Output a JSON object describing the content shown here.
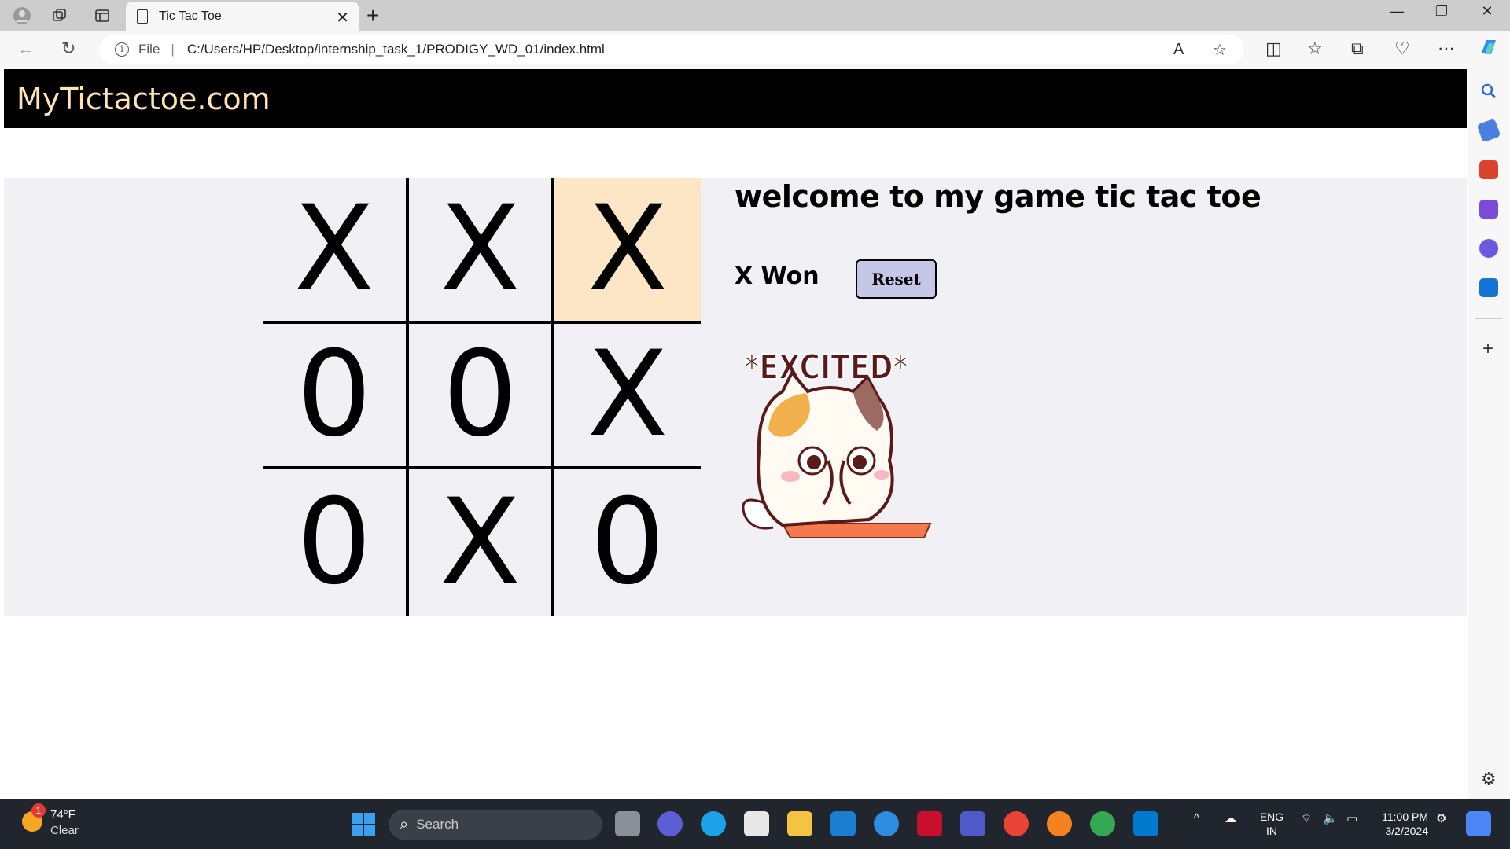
{
  "browser": {
    "tab_title": "Tic Tac Toe",
    "address_prefix": "File",
    "url": "C:/Users/HP/Desktop/internship_task_1/PRODIGY_WD_01/index.html"
  },
  "page": {
    "brand": "MyTictactoe.com",
    "welcome": "welcome to my game tic tac toe",
    "status": "X Won",
    "reset_label": "Reset",
    "sticker_text": "*EXCITED*",
    "board": [
      "X",
      "X",
      "X",
      "0",
      "0",
      "X",
      "0",
      "X",
      "0"
    ]
  },
  "taskbar": {
    "weather_badge": "1",
    "temperature": "74°F",
    "condition": "Clear",
    "search_placeholder": "Search",
    "lang_top": "ENG",
    "lang_bottom": "IN",
    "time": "11:00 PM",
    "date": "3/2/2024"
  },
  "colors": {
    "navbar_bg": "#000000",
    "brand_text": "#ffe2b8",
    "winning_cell": "#fde6c6",
    "game_bg": "#f1f1f5",
    "reset_bg": "#c6c6e6"
  }
}
